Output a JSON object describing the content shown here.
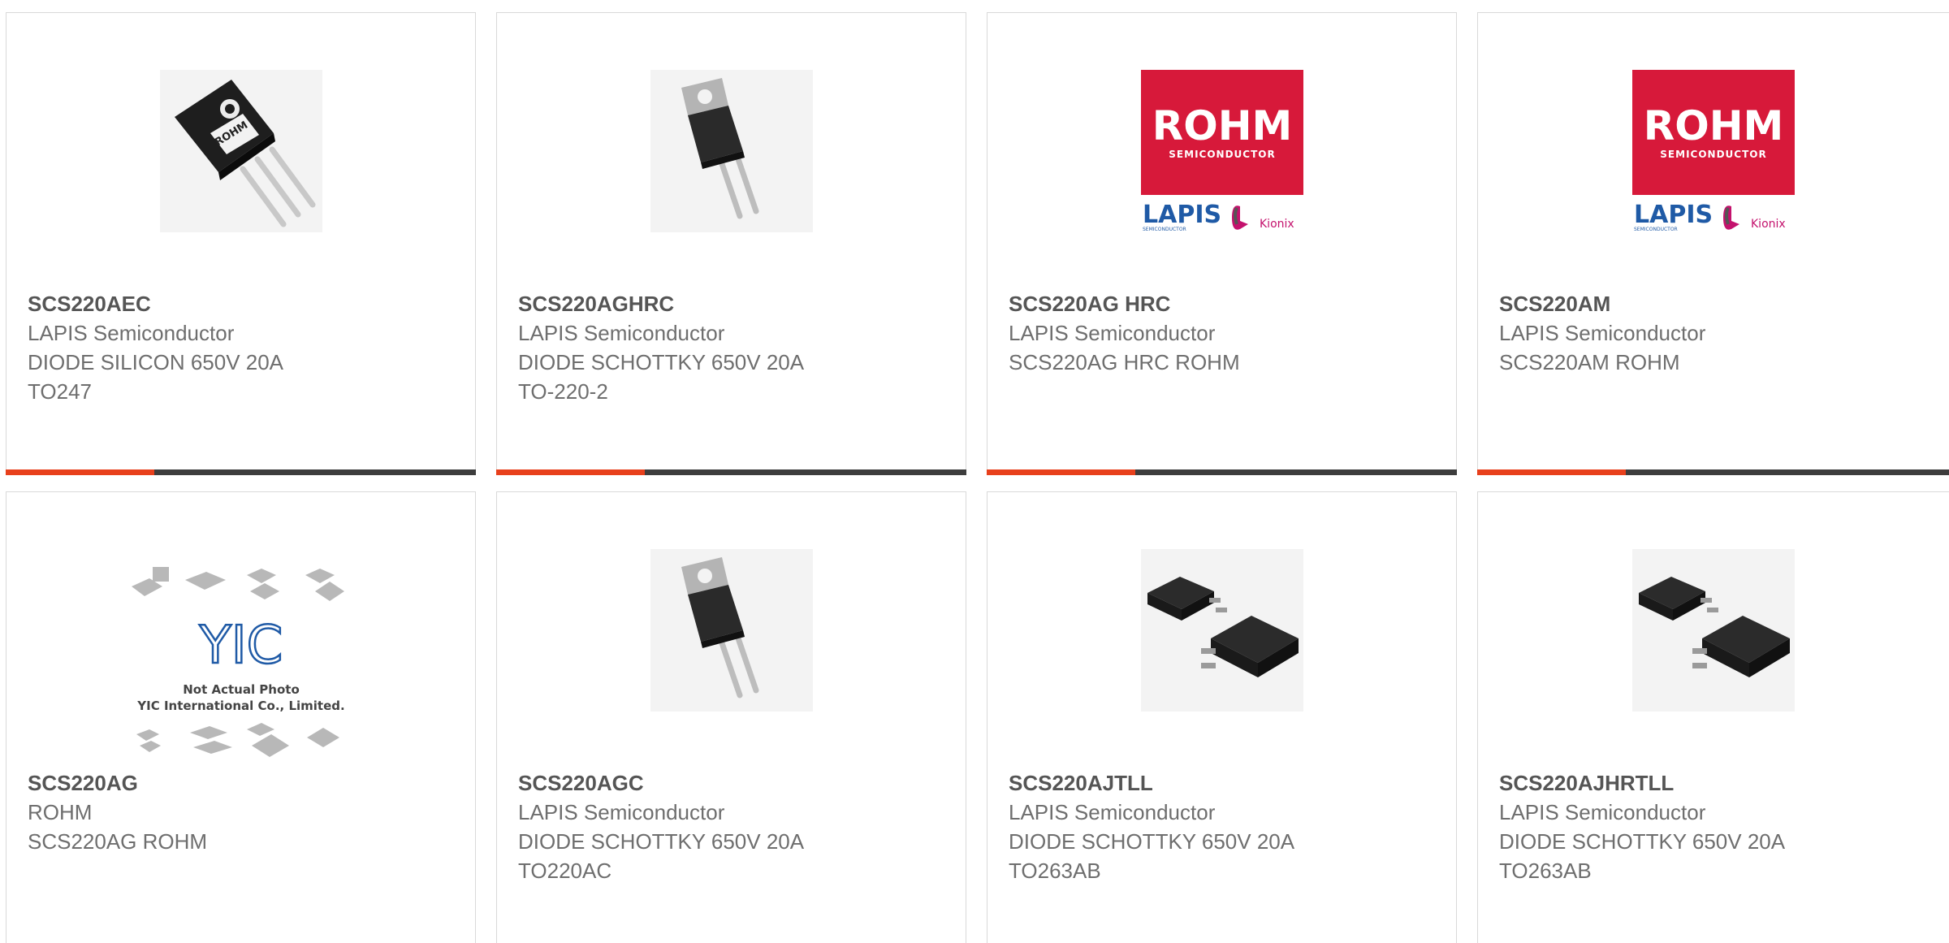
{
  "colors": {
    "accent": "#e8401c",
    "bar_dark": "#3d3d3d",
    "rohm_red": "#d7193a",
    "lapis_blue": "#1f5aa6",
    "kionix_pink": "#c4126d"
  },
  "products": [
    {
      "part_number": "SCS220AEC",
      "manufacturer": "LAPIS Semiconductor",
      "description": "DIODE SILICON 650V 20A",
      "package": "TO247",
      "image_icon": "to247-package-icon"
    },
    {
      "part_number": "SCS220AGHRC",
      "manufacturer": "LAPIS Semiconductor",
      "description": "DIODE SCHOTTKY 650V 20A",
      "package": "TO-220-2",
      "image_icon": "to220-package-icon"
    },
    {
      "part_number": "SCS220AG HRC",
      "manufacturer": "LAPIS Semiconductor",
      "description": "SCS220AG HRC ROHM",
      "package": "",
      "image_icon": "rohm-logo"
    },
    {
      "part_number": "SCS220AM",
      "manufacturer": "LAPIS Semiconductor",
      "description": "SCS220AM ROHM",
      "package": "",
      "image_icon": "rohm-logo"
    },
    {
      "part_number": "SCS220AG",
      "manufacturer": "ROHM",
      "description": "SCS220AG ROHM",
      "package": "",
      "image_icon": "not-actual-photo-placeholder"
    },
    {
      "part_number": "SCS220AGC",
      "manufacturer": "LAPIS Semiconductor",
      "description": "DIODE SCHOTTKY 650V 20A",
      "package": "TO220AC",
      "image_icon": "to220-package-icon"
    },
    {
      "part_number": "SCS220AJTLL",
      "manufacturer": "LAPIS Semiconductor",
      "description": "DIODE SCHOTTKY 650V 20A",
      "package": "TO263AB",
      "image_icon": "to263-package-icon"
    },
    {
      "part_number": "SCS220AJHRTLL",
      "manufacturer": "LAPIS Semiconductor",
      "description": "DIODE SCHOTTKY 650V 20A",
      "package": "TO263AB",
      "image_icon": "to263-package-icon"
    }
  ],
  "logos": {
    "rohm": "ROHM",
    "rohm_sub": "SEMICONDUCTOR",
    "lapis": "LAPIS",
    "lapis_sub": "SEMICONDUCTOR",
    "kionix": "Kionix"
  },
  "placeholder": {
    "brand": "YIC",
    "line1": "Not Actual Photo",
    "line2": "YIC International Co., Limited."
  }
}
